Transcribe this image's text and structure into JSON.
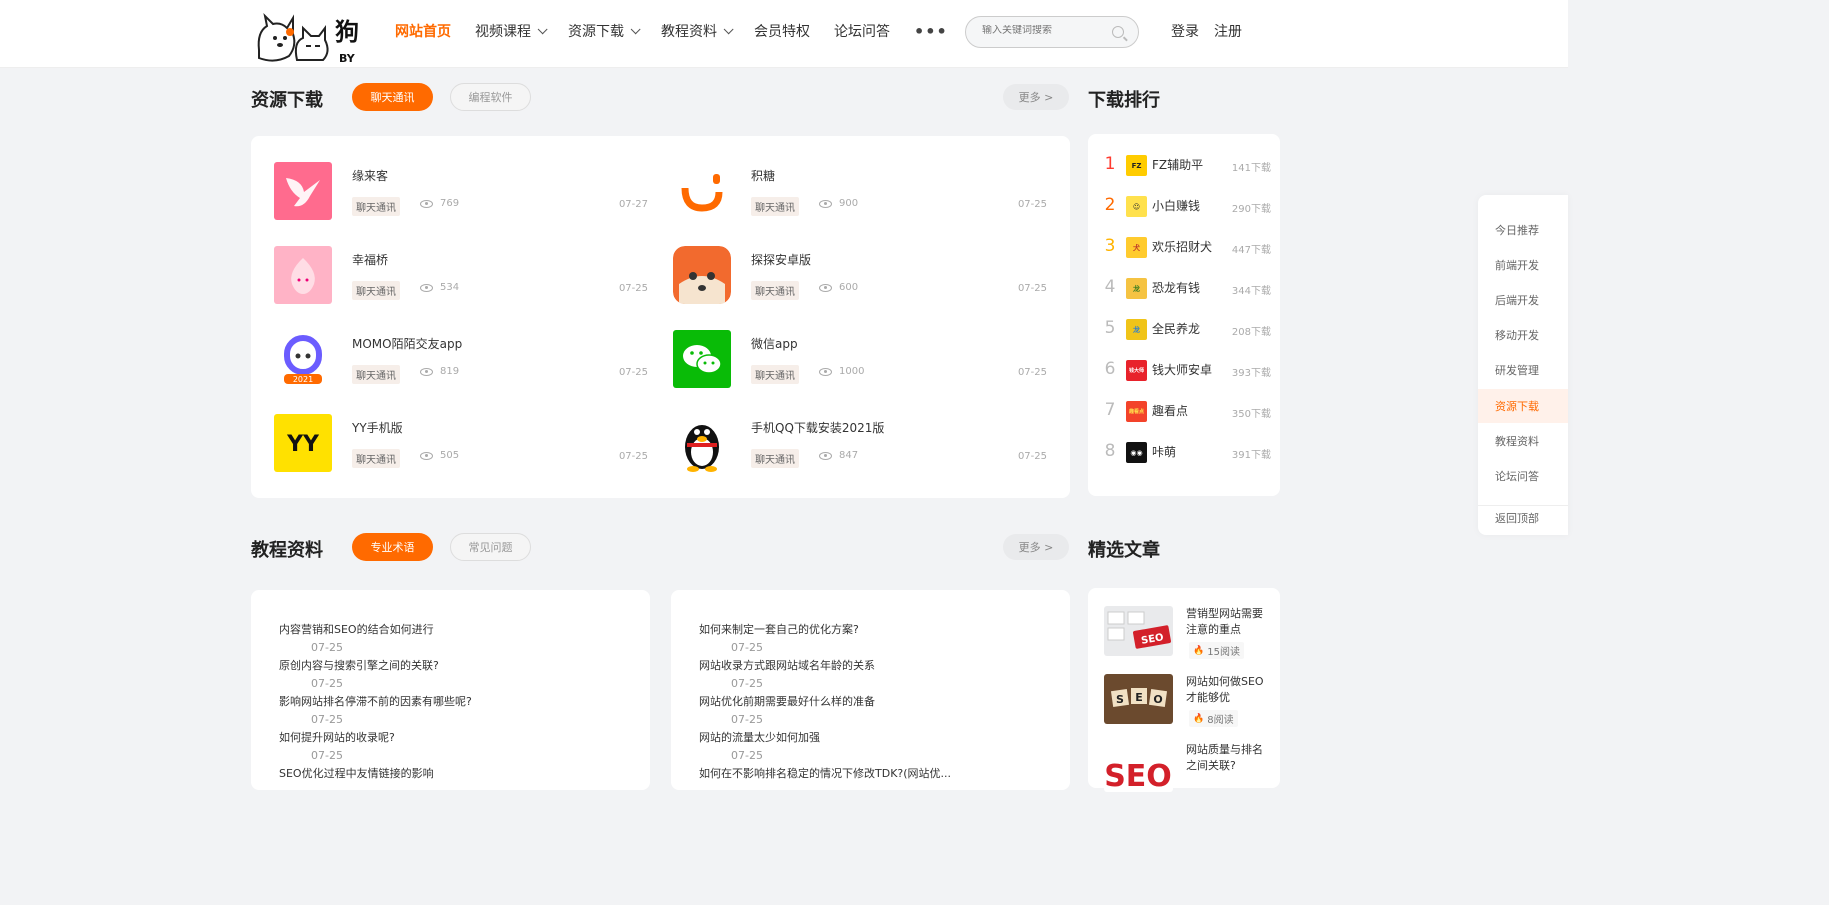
{
  "header": {
    "logo_text": "BY",
    "nav": [
      {
        "label": "网站首页",
        "active": true,
        "dropdown": false
      },
      {
        "label": "视频课程",
        "active": false,
        "dropdown": true
      },
      {
        "label": "资源下载",
        "active": false,
        "dropdown": true
      },
      {
        "label": "教程资料",
        "active": false,
        "dropdown": true
      },
      {
        "label": "会员特权",
        "active": false,
        "dropdown": false
      },
      {
        "label": "论坛问答",
        "active": false,
        "dropdown": false
      }
    ],
    "more_label": "•••",
    "search_placeholder": "输入关键词搜索",
    "login": "登录",
    "register": "注册"
  },
  "resources": {
    "title": "资源下载",
    "tabs": [
      "聊天通讯",
      "编程软件"
    ],
    "more": "更多 >",
    "items": [
      {
        "name": "缘来客",
        "tag": "聊天通讯",
        "views": "769",
        "date": "07-27",
        "icon": "hummingbird-icon",
        "color": "#ff6b8e"
      },
      {
        "name": "积糖",
        "tag": "聊天通讯",
        "views": "900",
        "date": "07-25",
        "icon": "jitang-icon",
        "color": "#ff6a00"
      },
      {
        "name": "幸福桥",
        "tag": "聊天通讯",
        "views": "534",
        "date": "07-25",
        "icon": "peach-icon",
        "color": "#ffb3c6"
      },
      {
        "name": "探探安卓版",
        "tag": "聊天通讯",
        "views": "600",
        "date": "07-25",
        "icon": "fox-icon",
        "color": "#f26a2e"
      },
      {
        "name": "MOMO陌陌交友app",
        "tag": "聊天通讯",
        "views": "819",
        "date": "07-25",
        "icon": "momo-icon",
        "color": "#6b5cff"
      },
      {
        "name": "微信app",
        "tag": "聊天通讯",
        "views": "1000",
        "date": "07-25",
        "icon": "wechat-icon",
        "color": "#09bb07"
      },
      {
        "name": "YY手机版",
        "tag": "聊天通讯",
        "views": "505",
        "date": "07-25",
        "icon": "yy-icon",
        "color": "#ffe100"
      },
      {
        "name": "手机QQ下载安装2021版",
        "tag": "聊天通讯",
        "views": "847",
        "date": "07-25",
        "icon": "qq-penguin-icon",
        "color": "#111111"
      }
    ]
  },
  "ranking": {
    "title": "下载排行",
    "items": [
      {
        "rank": "1",
        "name": "FZ辅助平",
        "downloads": "141下载",
        "logo_text": "FZ",
        "logo_bg": "#ffcc00",
        "logo_fg": "#222",
        "num_color": "#ff3b30"
      },
      {
        "rank": "2",
        "name": "小白赚钱",
        "downloads": "290下载",
        "logo_text": "☺",
        "logo_bg": "#ffe14d",
        "logo_fg": "#333",
        "num_color": "#ff6a00"
      },
      {
        "rank": "3",
        "name": "欢乐招财犬",
        "downloads": "447下载",
        "logo_text": "犬",
        "logo_bg": "#ffcb2e",
        "logo_fg": "#c0392b",
        "num_color": "#ffb300"
      },
      {
        "rank": "4",
        "name": "恐龙有钱",
        "downloads": "344下载",
        "logo_text": "龙",
        "logo_bg": "#f5c342",
        "logo_fg": "#3a7d22",
        "num_color": "#bbbbbb"
      },
      {
        "rank": "5",
        "name": "全民养龙",
        "downloads": "208下载",
        "logo_text": "龙",
        "logo_bg": "#f0c419",
        "logo_fg": "#2b7fd3",
        "num_color": "#bbbbbb"
      },
      {
        "rank": "6",
        "name": "钱大师安卓",
        "downloads": "393下载",
        "logo_text": "钱大师",
        "logo_bg": "#e8222b",
        "logo_fg": "#fff",
        "num_color": "#bbbbbb"
      },
      {
        "rank": "7",
        "name": "趣看点",
        "downloads": "350下载",
        "logo_text": "趣看点",
        "logo_bg": "#f3432a",
        "logo_fg": "#ffe14d",
        "num_color": "#bbbbbb"
      },
      {
        "rank": "8",
        "name": "咔萌",
        "downloads": "391下载",
        "logo_text": "◉◉",
        "logo_bg": "#111111",
        "logo_fg": "#fff",
        "num_color": "#bbbbbb"
      }
    ]
  },
  "float_nav": {
    "items": [
      "今日推荐",
      "前端开发",
      "后端开发",
      "移动开发",
      "研发管理",
      "资源下载",
      "教程资料",
      "论坛问答"
    ],
    "active_index": 5,
    "back_top": "返回顶部"
  },
  "tutorials": {
    "title": "教程资料",
    "tabs": [
      "专业术语",
      "常见问题"
    ],
    "more": "更多 >",
    "left": [
      {
        "title": "内容营销和SEO的结合如何进行",
        "date": "07-25"
      },
      {
        "title": "原创内容与搜索引擎之间的关联?",
        "date": "07-25"
      },
      {
        "title": "影响网站排名停滞不前的因素有哪些呢?",
        "date": "07-25"
      },
      {
        "title": "如何提升网站的收录呢?",
        "date": "07-25"
      },
      {
        "title": "SEO优化过程中友情链接的影响",
        "date": ""
      }
    ],
    "right": [
      {
        "title": "如何来制定一套自己的优化方案?",
        "date": "07-25"
      },
      {
        "title": "网站收录方式跟网站域名年龄的关系",
        "date": "07-25"
      },
      {
        "title": "网站优化前期需要最好什么样的准备",
        "date": "07-25"
      },
      {
        "title": "网站的流量太少如何加强",
        "date": "07-25"
      },
      {
        "title": "如何在不影响排名稳定的情况下修改TDK?(网站优...",
        "date": ""
      }
    ]
  },
  "articles": {
    "title": "精选文章",
    "items": [
      {
        "title": "营销型网站需要注意的重点",
        "reads": "15阅读",
        "img": "keyboard-seo-image"
      },
      {
        "title": "网站如何做SEO才能够优",
        "reads": "8阅读",
        "img": "wood-blocks-seo-image"
      },
      {
        "title": "网站质量与排名之间关联?",
        "reads": "",
        "img": "seo-red-text-image"
      }
    ]
  }
}
